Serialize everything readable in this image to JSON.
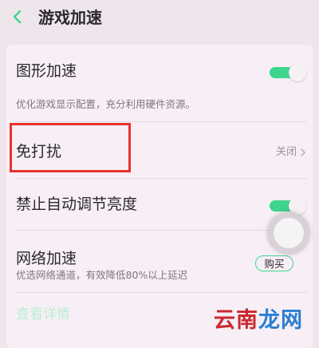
{
  "header": {
    "title": "游戏加速",
    "back_icon": "chevron-left-icon"
  },
  "settings": {
    "graphics_accel": {
      "label": "图形加速",
      "description": "优化游戏显示配置，充分利用硬件资源。",
      "enabled": true
    },
    "do_not_disturb": {
      "label": "免打扰",
      "value": "关闭",
      "icon": "chevron-right-icon"
    },
    "disable_auto_brightness": {
      "label": "禁止自动调节亮度",
      "enabled": true
    },
    "network_accel": {
      "label": "网络加速",
      "description": "优选网络通道，有效降低80%以上延迟",
      "button_label": "购买"
    },
    "faded_item": {
      "label": "查看详情"
    }
  },
  "watermark": {
    "part1": "云南",
    "part2": "龙网"
  },
  "colors": {
    "accent": "#3ed58e",
    "annotation": "#e8322c",
    "background": "#efe6ec",
    "card": "#f7eff5"
  }
}
